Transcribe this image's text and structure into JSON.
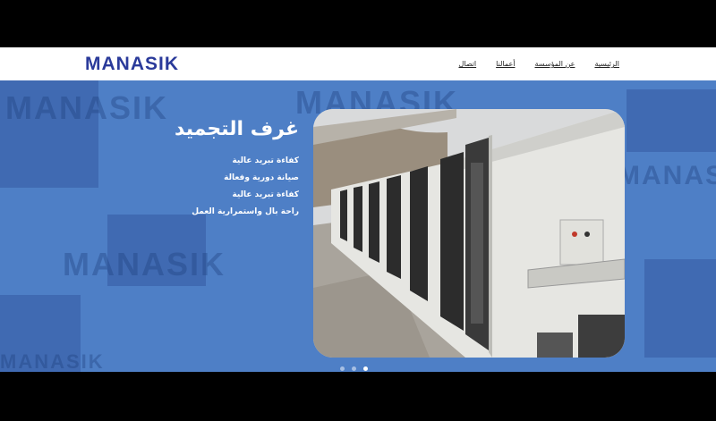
{
  "brand": {
    "logo_text": "MANASIK",
    "color": "#2a3a9a"
  },
  "nav": {
    "items": [
      {
        "label": "الرئيسية"
      },
      {
        "label": "عن المؤسسة"
      },
      {
        "label": "أعمالنا"
      },
      {
        "label": "اتصال"
      }
    ]
  },
  "hero": {
    "title": "غرف التجميد",
    "features": [
      "كفاءة تبريد عالية",
      "صيانة دورية وفعالة",
      "كفاءة تبريد عالية",
      "راحة بال واستمرارية العمل"
    ],
    "background_watermark": "MANASIK",
    "accent_color": "#4e7fc6"
  },
  "carousel": {
    "slide_count": 3,
    "active_index": 2
  }
}
